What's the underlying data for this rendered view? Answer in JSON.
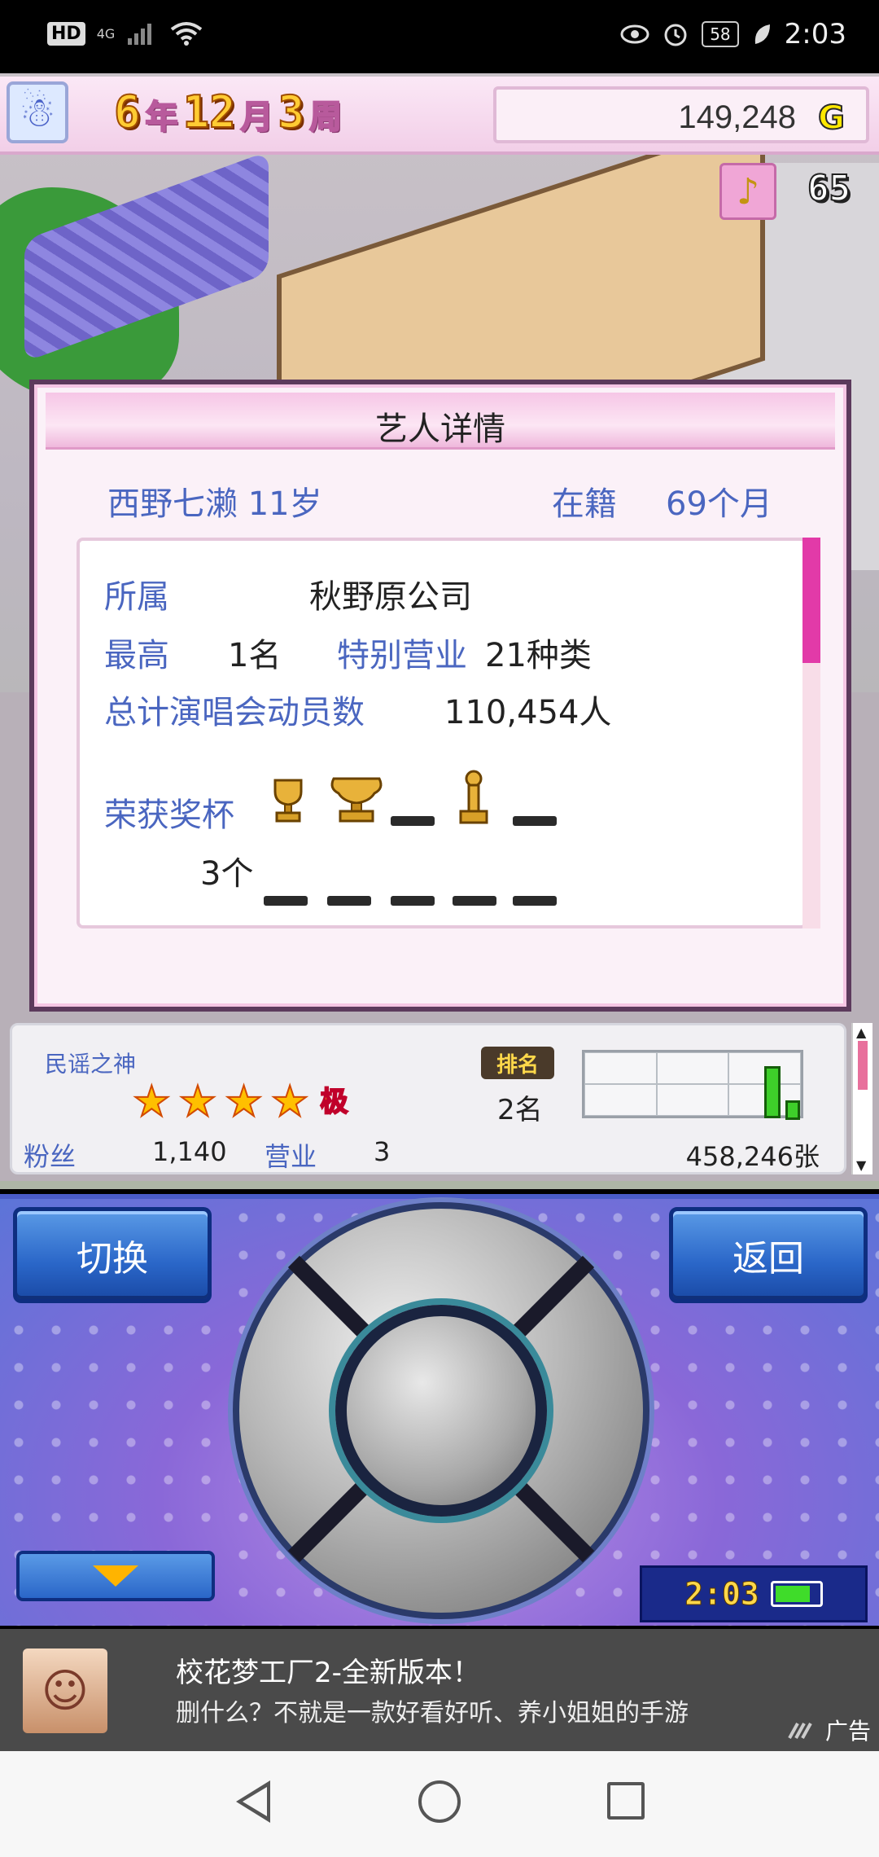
{
  "status_bar": {
    "hd": "HD",
    "network": "4G",
    "battery": "58",
    "time": "2:03"
  },
  "header": {
    "year": "6",
    "year_unit": "年",
    "month": "12",
    "month_unit": "月",
    "week": "3",
    "week_unit": "周",
    "money": "149,248",
    "currency": "G",
    "trophy_count": "65"
  },
  "dialog": {
    "title": "艺人详情",
    "artist_name": "西野七濑 11岁",
    "tenure_label": "在籍",
    "tenure_value": "69个月",
    "affiliation_label": "所属",
    "affiliation_value": "秋野原公司",
    "best_label": "最高",
    "best_value": "1名",
    "special_label": "特别营业",
    "special_value": "21种类",
    "concert_label": "总计演唱会动员数",
    "concert_value": "110,454人",
    "trophies_label": "荣获奖杯",
    "trophies_count": "3个",
    "trophy_slots_row1": [
      "trophy-cup",
      "trophy-cup-large",
      "empty",
      "trophy-award",
      "empty"
    ],
    "trophy_slots_row2": [
      "empty",
      "empty",
      "empty",
      "empty",
      "empty"
    ]
  },
  "info_panel": {
    "genre": "民谣之神",
    "stars": 4,
    "max_badge": "极",
    "rank_badge": "排名",
    "rank_value": "2名",
    "fans_label": "粉丝",
    "fans_value": "1,140",
    "business_label": "营业",
    "business_value": "3",
    "sales_value": "458,246张"
  },
  "controls": {
    "switch_label": "切换",
    "back_label": "返回",
    "clock_time": "2:03"
  },
  "ad": {
    "title": "校花梦工厂2-全新版本！",
    "subtitle": "删什么？不就是一款好看好听、养小姐姐的手游",
    "tag": "广告"
  },
  "colors": {
    "label_blue": "#4a66c0",
    "accent_pink": "#e23aa8",
    "button_blue": "#2a66c8",
    "rank_bar_green": "#3ecf2a"
  }
}
